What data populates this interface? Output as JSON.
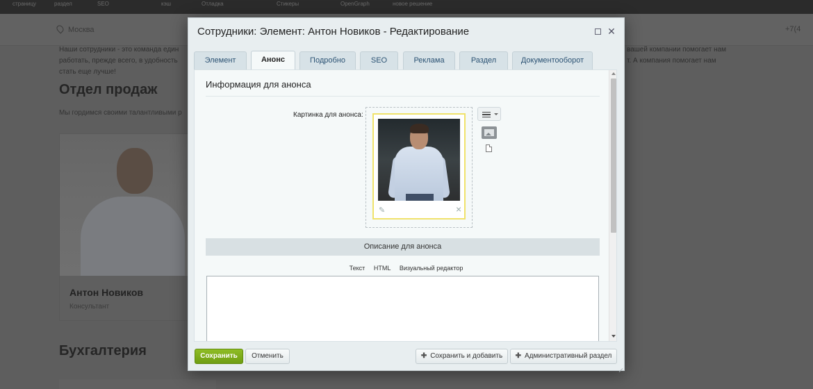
{
  "admin_bar": {
    "items": [
      {
        "label": "страницу",
        "sub": ""
      },
      {
        "label": "раздел",
        "sub": ""
      },
      {
        "label": "SEO",
        "sub": ""
      },
      {
        "label": "кэш",
        "sub": ""
      },
      {
        "label": "Отладка",
        "sub": ""
      },
      {
        "label": "Стикеры",
        "sub": ""
      },
      {
        "label": "OpenGraph",
        "sub": ""
      },
      {
        "label": "новое решение",
        "sub": ""
      }
    ]
  },
  "site": {
    "city": "Москва",
    "phone": "+7(4",
    "intro_left": "Наши сотрудники - это команда един",
    "intro_left_2": "работать, прежде всего, в удобность",
    "intro_left_3": "стать еще лучше!",
    "intro_right": "вашей компании помогает нам",
    "intro_right_2": "т. А компания помогает нам",
    "sales_heading": "Отдел продаж",
    "sales_text": "Мы гордимся своими талантливыми р",
    "employee_name": "Антон Новиков",
    "employee_position": "Консультант",
    "accounting_heading": "Бухгалтерия"
  },
  "modal": {
    "title": "Сотрудники: Элемент: Антон Новиков - Редактирование",
    "tabs": [
      {
        "label": "Элемент"
      },
      {
        "label": "Анонс"
      },
      {
        "label": "Подробно"
      },
      {
        "label": "SEO"
      },
      {
        "label": "Реклама"
      },
      {
        "label": "Раздел"
      },
      {
        "label": "Документооборот"
      }
    ],
    "active_tab": "Анонс",
    "section_title": "Информация для анонса",
    "picture_label": "Картинка для анонса:",
    "description_header": "Описание для анонса",
    "editor_modes": [
      "Текст",
      "HTML",
      "Визуальный редактор"
    ],
    "description_value": "",
    "buttons": {
      "save": "Сохранить",
      "cancel": "Отменить",
      "save_add": "Сохранить и добавить",
      "admin": "Административный раздел"
    }
  },
  "icons": {
    "menu": "menu-icon",
    "image": "image-icon",
    "file": "file-icon",
    "edit": "pencil-icon",
    "delete": "close-icon"
  },
  "colors": {
    "save_button": "#7aa81a",
    "image_frame": "#f0e26a",
    "tab_text": "#2b5273"
  }
}
